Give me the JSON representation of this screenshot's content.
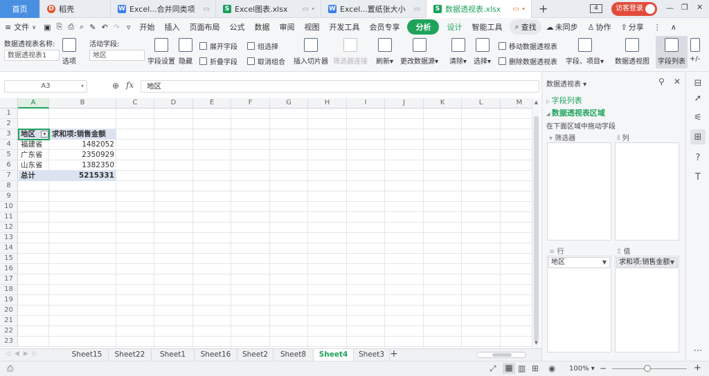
{
  "tabs": {
    "home": "首页",
    "items": [
      {
        "icon": "D",
        "label": "稻壳"
      },
      {
        "icon": "W",
        "label": "Excel...合并同类项"
      },
      {
        "icon": "S",
        "label": "Excel图表.xlsx"
      },
      {
        "icon": "W",
        "label": "Excel...置纸张大小"
      },
      {
        "icon": "S",
        "label": "数据透视表.xlsx"
      }
    ],
    "new_tab": "+",
    "window_count": "4",
    "login": "访客登录"
  },
  "menu": {
    "file": "文件",
    "items": [
      "开始",
      "插入",
      "页面布局",
      "公式",
      "数据",
      "审阅",
      "视图",
      "开发工具",
      "会员专享"
    ],
    "analyze": "分析",
    "design": "设计",
    "smart": "智能工具",
    "search": "查找",
    "sync": "未同步",
    "collab": "协作",
    "share": "分享"
  },
  "toolbar": {
    "pivot_name_label": "数据透视表名称:",
    "pivot_name_value": "数据透视表1",
    "options": "选项",
    "active_field_label": "活动字段:",
    "active_field_value": "地区",
    "field_settings": "字段设置",
    "hide": "隐藏",
    "expand_field": "展开字段",
    "collapse_field": "折叠字段",
    "group_select": "组选择",
    "ungroup": "取消组合",
    "insert_slicer": "插入切片器",
    "filter_connection": "筛选器连接",
    "refresh": "刷新",
    "change_source": "更改数据源",
    "clear": "清除",
    "select": "选择",
    "move_pivot": "移动数据透视表",
    "delete_pivot": "删除数据透视表",
    "fields_items": "字段、项目",
    "pivot_chart": "数据透视图",
    "field_list": "字段列表",
    "plus_minus": "+/-"
  },
  "formula": {
    "cell_ref": "A3",
    "fx": "fx",
    "content": "地区"
  },
  "sheet": {
    "columns": [
      "A",
      "B",
      "C",
      "D",
      "E",
      "F",
      "G",
      "H",
      "I",
      "J",
      "K",
      "L",
      "M"
    ],
    "rows": [
      "1",
      "2",
      "3",
      "4",
      "5",
      "6",
      "7",
      "8",
      "9",
      "10",
      "11",
      "12",
      "13",
      "14",
      "15",
      "16",
      "17",
      "18",
      "19",
      "20",
      "21",
      "22",
      "23"
    ],
    "pivot": {
      "header_a": "地区",
      "header_b": "求和项:销售金额",
      "rows": [
        {
          "region": "福建省",
          "value": "1482052"
        },
        {
          "region": "广东省",
          "value": "2350929"
        },
        {
          "region": "山东省",
          "value": "1382350"
        }
      ],
      "total_label": "总计",
      "total_value": "5215331"
    }
  },
  "sheet_tabs": [
    "Sheet15",
    "Sheet22",
    "Sheet1",
    "Sheet16",
    "Sheet2",
    "Sheet8",
    "Sheet4",
    "Sheet3"
  ],
  "active_sheet": "Sheet4",
  "pane": {
    "title": "数据透视表",
    "field_list": "字段列表",
    "area_title": "数据透视表区域",
    "hint": "在下面区域中拖动字段",
    "filter": "筛选器",
    "columns": "列",
    "rows": "行",
    "values": "值",
    "row_field": "地区",
    "value_field": "求和项:销售金额"
  },
  "status": {
    "zoom": "100%"
  }
}
